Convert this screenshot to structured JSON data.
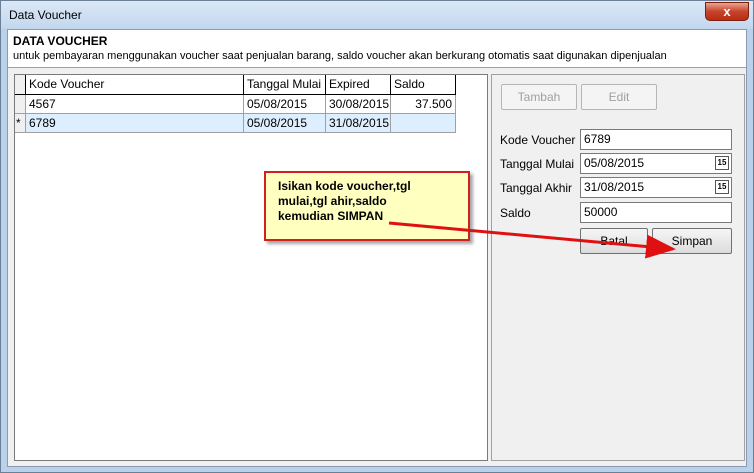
{
  "window": {
    "title": "Data Voucher",
    "close_label": "x"
  },
  "header": {
    "title": "DATA VOUCHER",
    "description": "untuk pembayaran menggunakan voucher saat penjualan barang, saldo voucher akan berkurang otomatis saat digunakan dipenjualan"
  },
  "grid": {
    "columns": [
      "Kode Voucher",
      "Tanggal Mulai",
      "Expired",
      "Saldo"
    ],
    "rows": [
      {
        "indicator": "",
        "kode": "4567",
        "mulai": "05/08/2015",
        "expired": "30/08/2015",
        "saldo": "37.500"
      },
      {
        "indicator": "*",
        "kode": "6789",
        "mulai": "05/08/2015",
        "expired": "31/08/2015",
        "saldo": ""
      }
    ]
  },
  "form": {
    "tambah_label": "Tambah",
    "edit_label": "Edit",
    "kode_label": "Kode Voucher",
    "kode_value": "6789",
    "mulai_label": "Tanggal Mulai",
    "mulai_value": "05/08/2015",
    "akhir_label": "Tanggal Akhir",
    "akhir_value": "31/08/2015",
    "saldo_label": "Saldo",
    "saldo_value": "50000",
    "batal_label": "Batal",
    "simpan_label": "Simpan",
    "calendar_glyph": "15"
  },
  "callout": {
    "line1": "Isikan kode voucher,tgl",
    "line2": "mulai,tgl ahir,saldo",
    "line3": "kemudian SIMPAN"
  },
  "colors": {
    "callout_border": "#d02020",
    "callout_bg": "#ffffc0",
    "arrow": "#e01010",
    "selected_row": "#ddeeff"
  },
  "icons": {
    "calendar": "calendar-icon",
    "close": "close-icon"
  }
}
